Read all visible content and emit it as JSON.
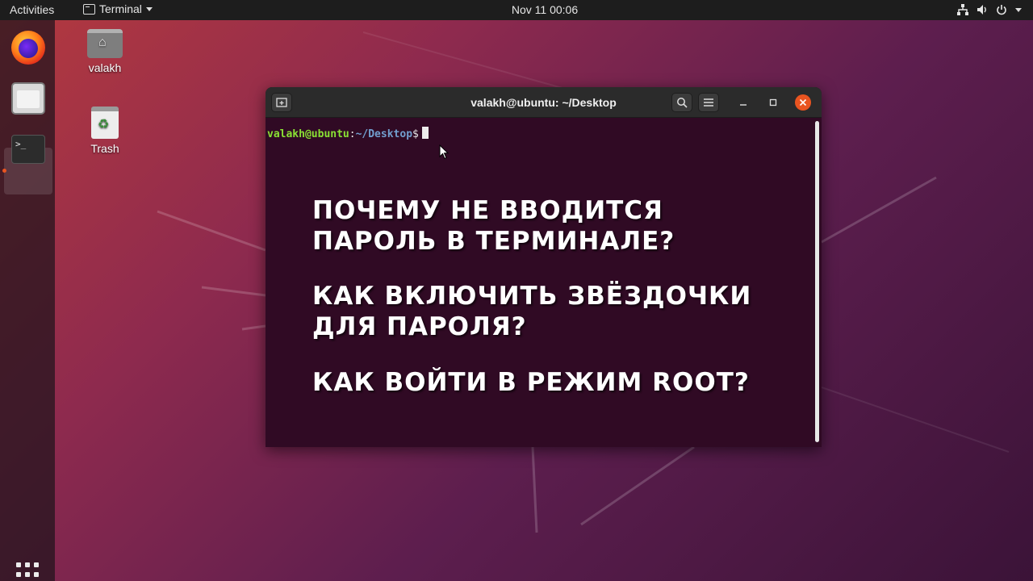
{
  "topbar": {
    "activities": "Activities",
    "app_name": "Terminal",
    "clock": "Nov 11  00:06",
    "status_icons": [
      "network-icon",
      "volume-icon",
      "power-icon"
    ]
  },
  "dock": {
    "items": [
      "firefox-icon",
      "files-icon",
      "terminal-icon"
    ],
    "show_apps": "apps-grid-icon"
  },
  "desktop": {
    "home_label": "valakh",
    "trash_label": "Trash"
  },
  "terminal": {
    "title": "valakh@ubuntu: ~/Desktop",
    "prompt_user": "valakh@ubuntu",
    "prompt_colon": ":",
    "prompt_path": "~/Desktop",
    "prompt_symbol": "$"
  },
  "overlay": {
    "line1": "ПОЧЕМУ НЕ ВВОДИТСЯ",
    "line2": "ПАРОЛЬ В ТЕРМИНАЛЕ?",
    "line3": "КАК ВКЛЮЧИТЬ ЗВЁЗДОЧКИ",
    "line4": "ДЛЯ ПАРОЛЯ?",
    "line5": "КАК ВОЙТИ В РЕЖИМ ROOT?"
  },
  "colors": {
    "accent": "#e95420",
    "terminal_bg": "#300a24",
    "prompt_user": "#8ae234",
    "prompt_path": "#729fcf"
  }
}
